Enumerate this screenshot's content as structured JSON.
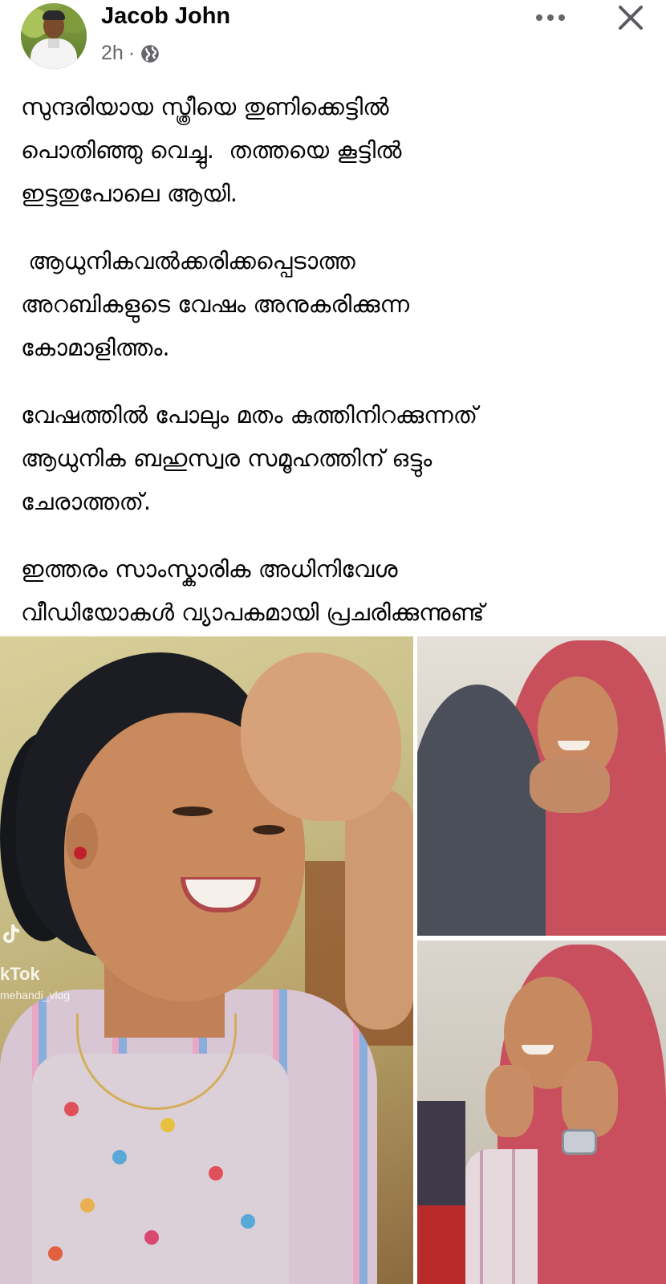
{
  "post": {
    "author": {
      "name": "Jacob John",
      "time": "2h",
      "separator": "·",
      "privacy_icon": "globe-icon"
    },
    "header_actions": {
      "more_icon": "more-horizontal-icon",
      "close_icon": "close-icon"
    },
    "text_paragraphs": [
      "സുന്ദരിയായ സ്ത്രീയെ തുണിക്കെട്ടിൽ\nപൊതിഞ്ഞു വെച്ചു.  തത്തയെ കൂട്ടിൽ\nഇട്ടതുപോലെ ആയി.",
      " ആധുനികവൽക്കരിക്കപ്പെടാത്ത\nഅറബികളുടെ വേഷം അനുകരിക്കുന്ന\nകോമാളിത്തം.",
      "വേഷത്തിൽ പോലും മതം കുത്തിനിറക്കുന്നത്\nആധുനിക ബഹുസ്വര സമൂഹത്തിന് ഒട്ടും\nചേരാത്തത്.",
      "ഇത്തരം സാംസ്കാരിക അധിനിവേശ\nവീഡിയോകൾ വ്യാപകമായി പ്രചരിക്കുന്നുണ്ട്"
    ],
    "photos": {
      "main_watermark": "kTok",
      "main_watermark_handle": "mehandi_vlog"
    }
  },
  "colors": {
    "name": "#050505",
    "meta": "#65676b",
    "icon": "#65676b"
  }
}
